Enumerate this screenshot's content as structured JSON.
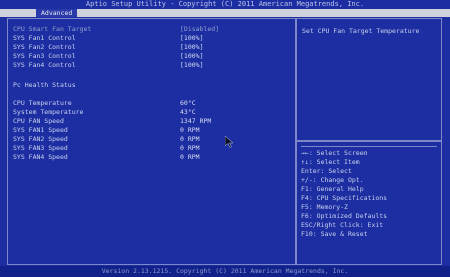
{
  "app": {
    "title": "Aptio Setup Utility - Copyright (C) 2011 American Megatrends, Inc."
  },
  "tabs": [
    {
      "label": "Advanced"
    }
  ],
  "settings": [
    {
      "label": "CPU Smart Fan Target",
      "value": "[Disabled]",
      "selected": true
    },
    {
      "label": "SYS Fan1 Control",
      "value": "[100%]"
    },
    {
      "label": "SYS Fan2 Control",
      "value": "[100%]"
    },
    {
      "label": "SYS Fan3 Control",
      "value": "[100%]"
    },
    {
      "label": "SYS Fan4 Control",
      "value": "[100%]"
    }
  ],
  "health": {
    "title": "Pc Health Status",
    "items": [
      {
        "label": "CPU Temperature",
        "value": "60°C"
      },
      {
        "label": "System Temperature",
        "value": "43°C"
      },
      {
        "label": "CPU FAN Speed",
        "value": "1347 RPM"
      },
      {
        "label": "SYS FAN1 Speed",
        "value": "0 RPM"
      },
      {
        "label": "SYS FAN2 Speed",
        "value": "0 RPM"
      },
      {
        "label": "SYS FAN3 Speed",
        "value": "0 RPM"
      },
      {
        "label": "SYS FAN4 Speed",
        "value": "0 RPM"
      }
    ]
  },
  "help": {
    "text": "Set CPU Fan Target Temperature"
  },
  "keys": [
    "→←: Select Screen",
    "↑↓: Select Item",
    "Enter: Select",
    "+/-: Change Opt.",
    "F1: General Help",
    "F4: CPU Specifications",
    "F5: Memory-Z",
    "F6: Optimized Defaults",
    "ESC/Right Click: Exit",
    "F10: Save & Reset"
  ],
  "footer": {
    "text": "Version 2.13.1215. Copyright (C) 2011 American Megatrends, Inc."
  },
  "colors": {
    "background": "#1c2ea2",
    "text": "#d6dcf2",
    "highlight": "#8fa0cc",
    "tabbar": "#cfd2dc"
  }
}
